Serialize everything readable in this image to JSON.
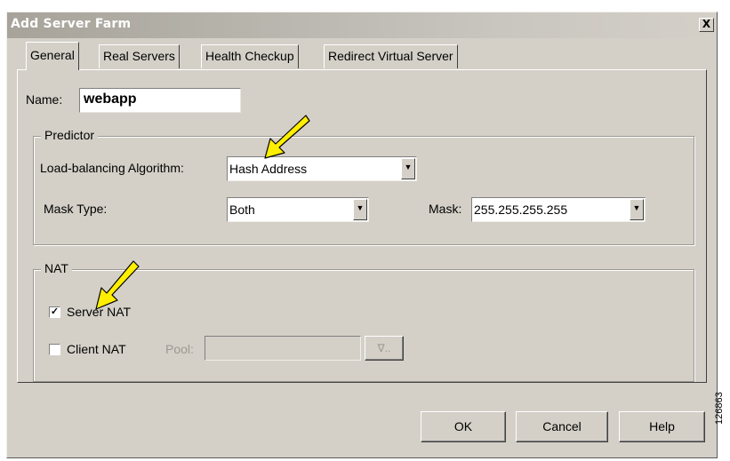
{
  "window": {
    "title": "Add Server Farm",
    "close_label": "X"
  },
  "tabs": [
    {
      "label": "General",
      "active": true
    },
    {
      "label": "Real Servers",
      "active": false
    },
    {
      "label": "Health Checkup",
      "active": false
    },
    {
      "label": "Redirect Virtual Server",
      "active": false
    }
  ],
  "name_field": {
    "label": "Name:",
    "value": "webapp"
  },
  "predictor": {
    "legend": "Predictor",
    "algorithm_label": "Load-balancing Algorithm:",
    "algorithm_value": "Hash Address",
    "mask_type_label": "Mask Type:",
    "mask_type_value": "Both",
    "mask_label": "Mask:",
    "mask_value": "255.255.255.255"
  },
  "nat": {
    "legend": "NAT",
    "server_nat_label": "Server NAT",
    "server_nat_checked": true,
    "client_nat_label": "Client NAT",
    "client_nat_checked": false,
    "pool_label": "Pool:",
    "pool_value": "",
    "pool_button_label": "∇.."
  },
  "buttons": {
    "ok": "OK",
    "cancel": "Cancel",
    "help": "Help"
  },
  "figure_id": "126863",
  "icons": {
    "dropdown": "chevron-down-icon",
    "check": "checkmark-icon",
    "callout": "yellow-arrow-icon"
  },
  "colors": {
    "dialog_bg": "#d4d0c8",
    "callout_arrow": "#ffee00"
  }
}
